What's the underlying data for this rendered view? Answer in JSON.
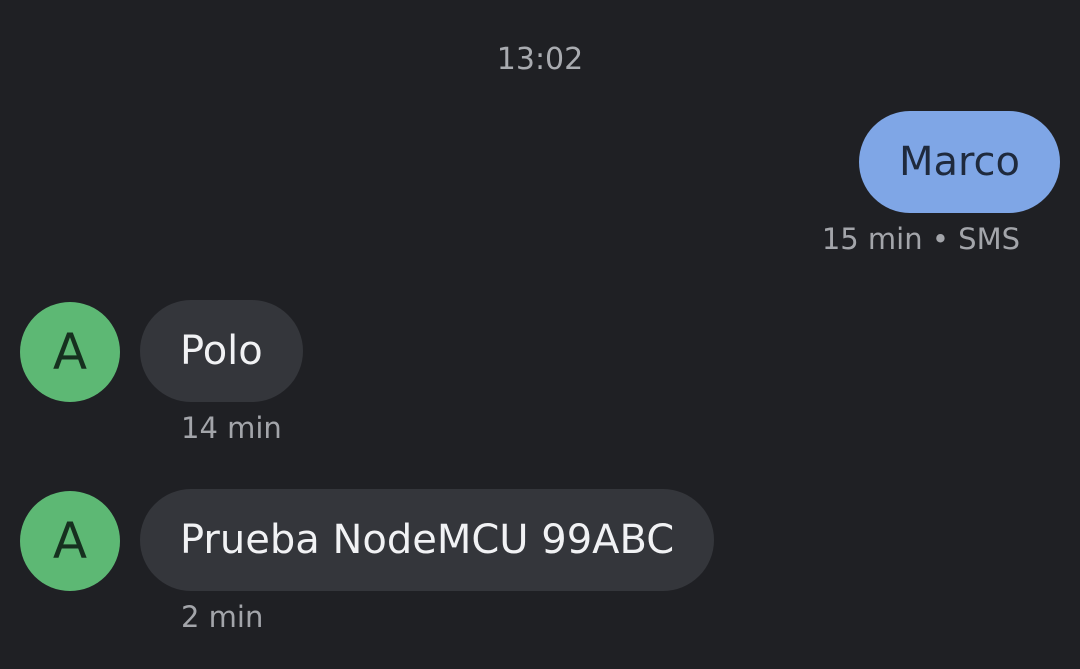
{
  "conversation": {
    "timestamp": "13:02",
    "messages": [
      {
        "direction": "outgoing",
        "text": "Marco",
        "meta": "15 min • SMS"
      },
      {
        "direction": "incoming",
        "avatar_letter": "A",
        "text": "Polo",
        "meta": "14 min"
      },
      {
        "direction": "incoming",
        "avatar_letter": "A",
        "text": "Prueba NodeMCU 99ABC",
        "meta": "2 min"
      }
    ]
  },
  "colors": {
    "background": "#1f2024",
    "outgoing_bubble": "#7fa6e6",
    "incoming_bubble": "#34363b",
    "avatar": "#5db874",
    "meta_text": "#a3a5aa"
  }
}
